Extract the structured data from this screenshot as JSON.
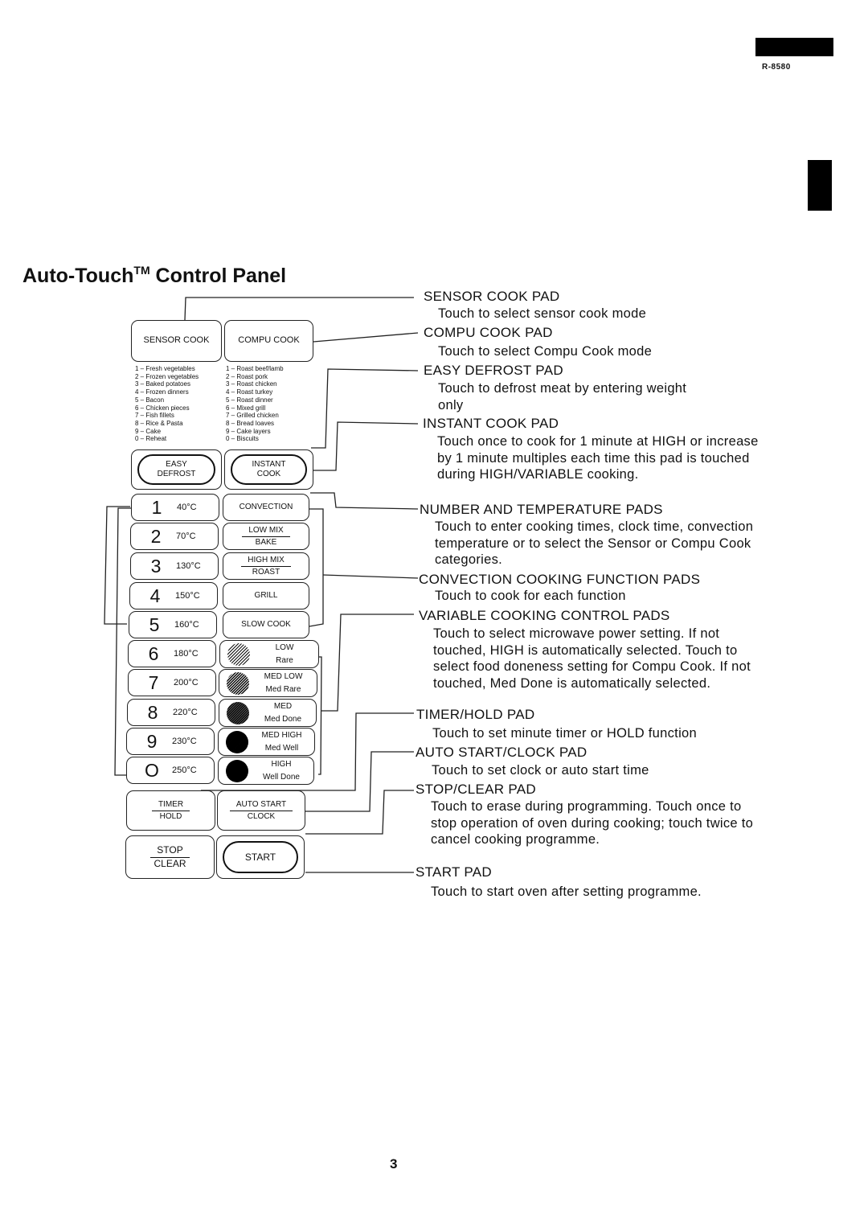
{
  "header": {
    "model": "R-8580",
    "page_number": "3"
  },
  "title": {
    "main": "Auto-Touch",
    "trademark": "TM",
    "rest": " Control Panel"
  },
  "panel": {
    "sensor_cook": "SENSOR COOK",
    "compu_cook": "COMPU COOK",
    "sensor_categories": [
      "1 – Fresh vegetables",
      "2 – Frozen vegetables",
      "3 – Baked potatoes",
      "4 – Frozen dinners",
      "5 – Bacon",
      "6 – Chicken pieces",
      "7 – Fish fillets",
      "8 – Rice & Pasta",
      "9 – Cake",
      "0 – Reheat"
    ],
    "compu_categories": [
      "1 – Roast beef/lamb",
      "2 – Roast pork",
      "3 – Roast chicken",
      "4 – Roast turkey",
      "5 – Roast dinner",
      "6 – Mixed grill",
      "7 – Grilled chicken",
      "8 – Bread loaves",
      "9 – Cake layers",
      "0 – Biscuits"
    ],
    "easy_defrost": [
      "EASY",
      "DEFROST"
    ],
    "instant_cook": [
      "INSTANT",
      "COOK"
    ],
    "number_pads": [
      {
        "digit": "1",
        "temp": "40°C"
      },
      {
        "digit": "2",
        "temp": "70°C"
      },
      {
        "digit": "3",
        "temp": "130°C"
      },
      {
        "digit": "4",
        "temp": "150°C"
      },
      {
        "digit": "5",
        "temp": "160°C"
      },
      {
        "digit": "6",
        "temp": "180°C"
      },
      {
        "digit": "7",
        "temp": "200°C"
      },
      {
        "digit": "8",
        "temp": "220°C"
      },
      {
        "digit": "9",
        "temp": "230°C"
      },
      {
        "digit": "O",
        "temp": "250°C"
      }
    ],
    "convection_pads": [
      {
        "single": "CONVECTION"
      },
      {
        "top": "LOW MIX",
        "bottom": "BAKE"
      },
      {
        "top": "HIGH MIX",
        "bottom": "ROAST"
      },
      {
        "single": "GRILL"
      },
      {
        "single": "SLOW COOK"
      }
    ],
    "variable_pads": [
      {
        "power": "LOW",
        "doneness": "Rare",
        "icon": "hatch-light-icon"
      },
      {
        "power": "MED LOW",
        "doneness": "Med Rare",
        "icon": "hatch-medium-light-icon"
      },
      {
        "power": "MED",
        "doneness": "Med Done",
        "icon": "hatch-medium-icon"
      },
      {
        "power": "MED HIGH",
        "doneness": "Med Well",
        "icon": "hatch-dense-icon"
      },
      {
        "power": "HIGH",
        "doneness": "Well Done",
        "icon": "solid-circle-icon"
      }
    ],
    "timer_hold": {
      "top": "TIMER",
      "bottom": "HOLD"
    },
    "auto_start_clock": {
      "top": "AUTO START",
      "bottom": "CLOCK"
    },
    "stop_clear": {
      "top": "STOP",
      "bottom": "CLEAR"
    },
    "start": "START"
  },
  "descriptions": [
    {
      "heading": "SENSOR COOK PAD",
      "text": "Touch to select sensor cook mode"
    },
    {
      "heading": "COMPU COOK PAD",
      "text": "Touch to select Compu Cook mode"
    },
    {
      "heading": "EASY DEFROST PAD",
      "text": "Touch to defrost meat by entering weight only"
    },
    {
      "heading": "INSTANT COOK PAD",
      "text": "Touch once to cook for 1 minute at HIGH or increase by 1 minute multiples each time this pad is touched during HIGH/VARIABLE cooking."
    },
    {
      "heading": "NUMBER AND TEMPERATURE PADS",
      "text": "Touch to enter cooking times, clock time, convection temperature or to select the Sensor or Compu Cook categories."
    },
    {
      "heading": "CONVECTION COOKING FUNCTION PADS",
      "text": "Touch to cook for each function"
    },
    {
      "heading": "VARIABLE COOKING CONTROL PADS",
      "text": "Touch to select microwave power setting. If not touched, HIGH is automatically selected. Touch to select food doneness setting for Compu Cook. If not touched, Med Done is automatically selected."
    },
    {
      "heading": "TIMER/HOLD PAD",
      "text": "Touch to set minute timer or HOLD function"
    },
    {
      "heading": "AUTO START/CLOCK PAD",
      "text": "Touch to set clock or auto start time"
    },
    {
      "heading": "STOP/CLEAR PAD",
      "text": "Touch to erase during programming. Touch once to stop operation of oven during cooking; touch twice to cancel cooking programme."
    },
    {
      "heading": "START PAD",
      "text": "Touch to start oven after setting programme."
    }
  ]
}
